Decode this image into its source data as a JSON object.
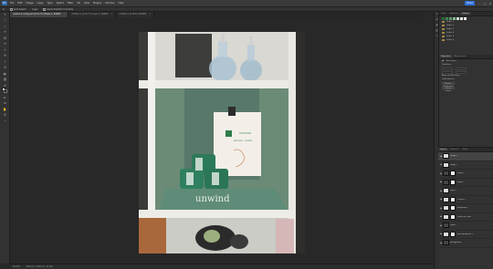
{
  "app": {
    "logo": "Ps",
    "menu": [
      "File",
      "Edit",
      "Image",
      "Layer",
      "Type",
      "Select",
      "Filter",
      "3D",
      "View",
      "Plugins",
      "Window",
      "Help"
    ],
    "share": "Share"
  },
  "options": {
    "auto_select": "Auto-Select:",
    "auto_select_target": "Layer",
    "transform": "Show Transform Controls"
  },
  "tabs": [
    {
      "label": "unwind-in-a-bag.psd @ 16.7% (Shape 2, RGB/8)",
      "active": true
    },
    {
      "label": "Untitled-1 @ 66.7% (Layer 1, RGB/8)",
      "active": false
    },
    {
      "label": "Untitled-2 @ 100% (RGB/8)",
      "active": false
    }
  ],
  "tools": [
    "↖",
    "⬚",
    "◌",
    "⌖",
    "⊡",
    "✂",
    "⊹",
    "✎",
    "⌇",
    "⎚",
    "◐",
    "▥",
    "✐",
    "T",
    "▸",
    "▭",
    "✋",
    "⚲",
    "⋯"
  ],
  "photo": {
    "card_line1": "CHOOSE",
    "card_line2": "self-care · unwind",
    "shelf_text": "unwind"
  },
  "status": {
    "zoom": "16.67%",
    "doc_size": "3024 px x 4032 px (72 ppi)"
  },
  "panels": {
    "top_tabs": [
      "Color",
      "Swatches",
      "History"
    ],
    "history_items": [
      "Folder 1",
      "Folder 2",
      "Folder 3",
      "Folder 4",
      "Folder 5",
      "Folder 6"
    ],
    "mid_tabs": [
      "Properties",
      "Adjustments"
    ],
    "prop_title": "Pixel Layer",
    "prop_transform": "Transform",
    "prop_align": "Align and Distribute",
    "prop_quick": "Quick Actions",
    "prop_btn1": "Remove Background",
    "prop_btn2": "Select Subject",
    "swatch_colors": [
      "#2b6b3f",
      "#3c8650",
      "#5a9c6a",
      "#8ab78e",
      "#c9dfc9",
      "#e8f0e8",
      "#ffffff"
    ]
  },
  "layers": {
    "tabs": [
      "Layers",
      "Channels",
      "Paths"
    ],
    "items": [
      {
        "name": "Shape 2",
        "sel": true
      },
      {
        "name": "Shape 1",
        "sel": false
      },
      {
        "name": "Layer 4",
        "sel": false
      },
      {
        "name": "Layer 3",
        "sel": false
      },
      {
        "name": "Layer 2",
        "sel": false
      },
      {
        "name": "Curves 1",
        "sel": false
      },
      {
        "name": "Brightness",
        "sel": false
      },
      {
        "name": "Selective Color",
        "sel": false
      },
      {
        "name": "Layer 1",
        "sel": false
      },
      {
        "name": "Hue/Saturation 1",
        "sel": false
      },
      {
        "name": "Background",
        "sel": false
      }
    ]
  }
}
